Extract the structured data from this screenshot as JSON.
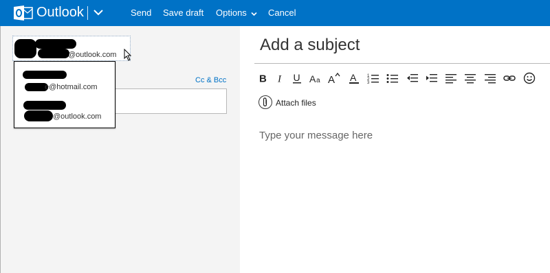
{
  "app": {
    "name": "Outlook"
  },
  "commands": {
    "send": "Send",
    "save_draft": "Save draft",
    "options": "Options",
    "cancel": "Cancel"
  },
  "from": {
    "address_suffix": "@outlook.com"
  },
  "recipients": {
    "cc_bcc": "Cc & Bcc",
    "suggestions": [
      {
        "suffix": "e@hotmail.com"
      },
      {
        "suffix": "@outlook.com"
      }
    ]
  },
  "subject": {
    "placeholder": "Add a subject"
  },
  "toolbar": {
    "buttons": [
      "bold",
      "italic",
      "underline",
      "font-size",
      "grow-font",
      "font-color",
      "numbered-list",
      "bullet-list",
      "decrease-indent",
      "increase-indent",
      "align-left",
      "align-center",
      "align-right",
      "insert-link",
      "emoji"
    ],
    "attach_label": "Attach files"
  },
  "message": {
    "placeholder": "Type your message here"
  },
  "colors": {
    "brand": "#0072c6",
    "pane_gray": "#f4f4f4"
  }
}
